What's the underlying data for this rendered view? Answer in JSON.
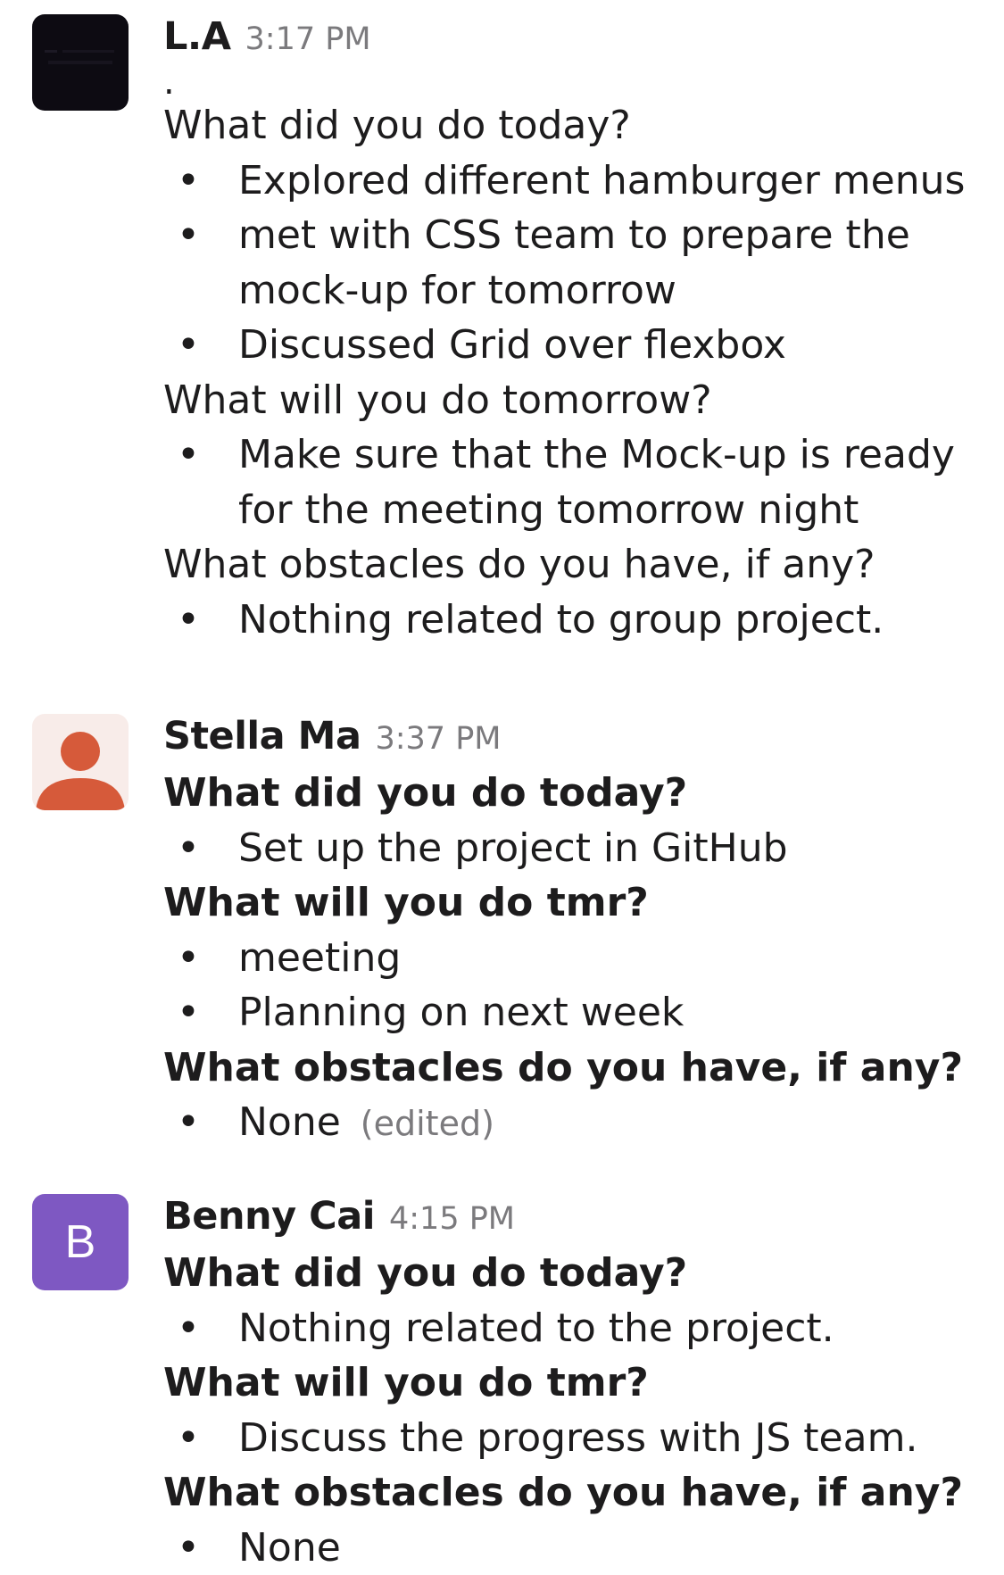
{
  "colors": {
    "text": "#1d1c1d",
    "timestamp": "#7b7a7d",
    "avatar_la_bg": "#0d0b12",
    "avatar_stella_bg": "#f8ece9",
    "avatar_stella_person": "#d65a3a",
    "avatar_benny_bg": "#7e58c2"
  },
  "messages": [
    {
      "author": "L.A",
      "time": "3:17 PM",
      "avatar_icon": "dark-logo-avatar",
      "lead": ".",
      "sections": [
        {
          "question": "What did you do today?",
          "bold": false,
          "items": [
            "Explored different hamburger menus",
            "met with CSS team to prepare the",
            "mock-up for tomorrow",
            "Discussed Grid over flexbox"
          ]
        },
        {
          "question": "What will you do tomorrow?",
          "bold": false,
          "items": [
            "Make sure that the Mock-up is ready",
            "for the meeting tomorrow night"
          ]
        },
        {
          "question": "What obstacles do you have, if any?",
          "bold": false,
          "items": [
            "Nothing related to group project."
          ]
        }
      ]
    },
    {
      "author": "Stella Ma",
      "time": "3:37 PM",
      "avatar_icon": "person-icon",
      "sections": [
        {
          "question": "What did you do today?",
          "bold": true,
          "items": [
            "Set up the project in GitHub"
          ]
        },
        {
          "question": "What will you do tmr?",
          "bold": true,
          "items": [
            "meeting",
            "Planning on next week"
          ]
        },
        {
          "question": "What obstacles do you have, if any?",
          "bold": true,
          "items": [
            "None"
          ]
        }
      ],
      "edited_label": "(edited)"
    },
    {
      "author": "Benny Cai",
      "time": "4:15 PM",
      "avatar_letter": "B",
      "sections": [
        {
          "question": "What did you do today?",
          "bold": true,
          "items": [
            "Nothing related to the project."
          ]
        },
        {
          "question": "What will you do tmr?",
          "bold": true,
          "items": [
            "Discuss the progress with JS team."
          ]
        },
        {
          "question": "What obstacles do you have, if any?",
          "bold": true,
          "items": [
            "None"
          ]
        }
      ]
    }
  ],
  "bullet_glyph": "•"
}
